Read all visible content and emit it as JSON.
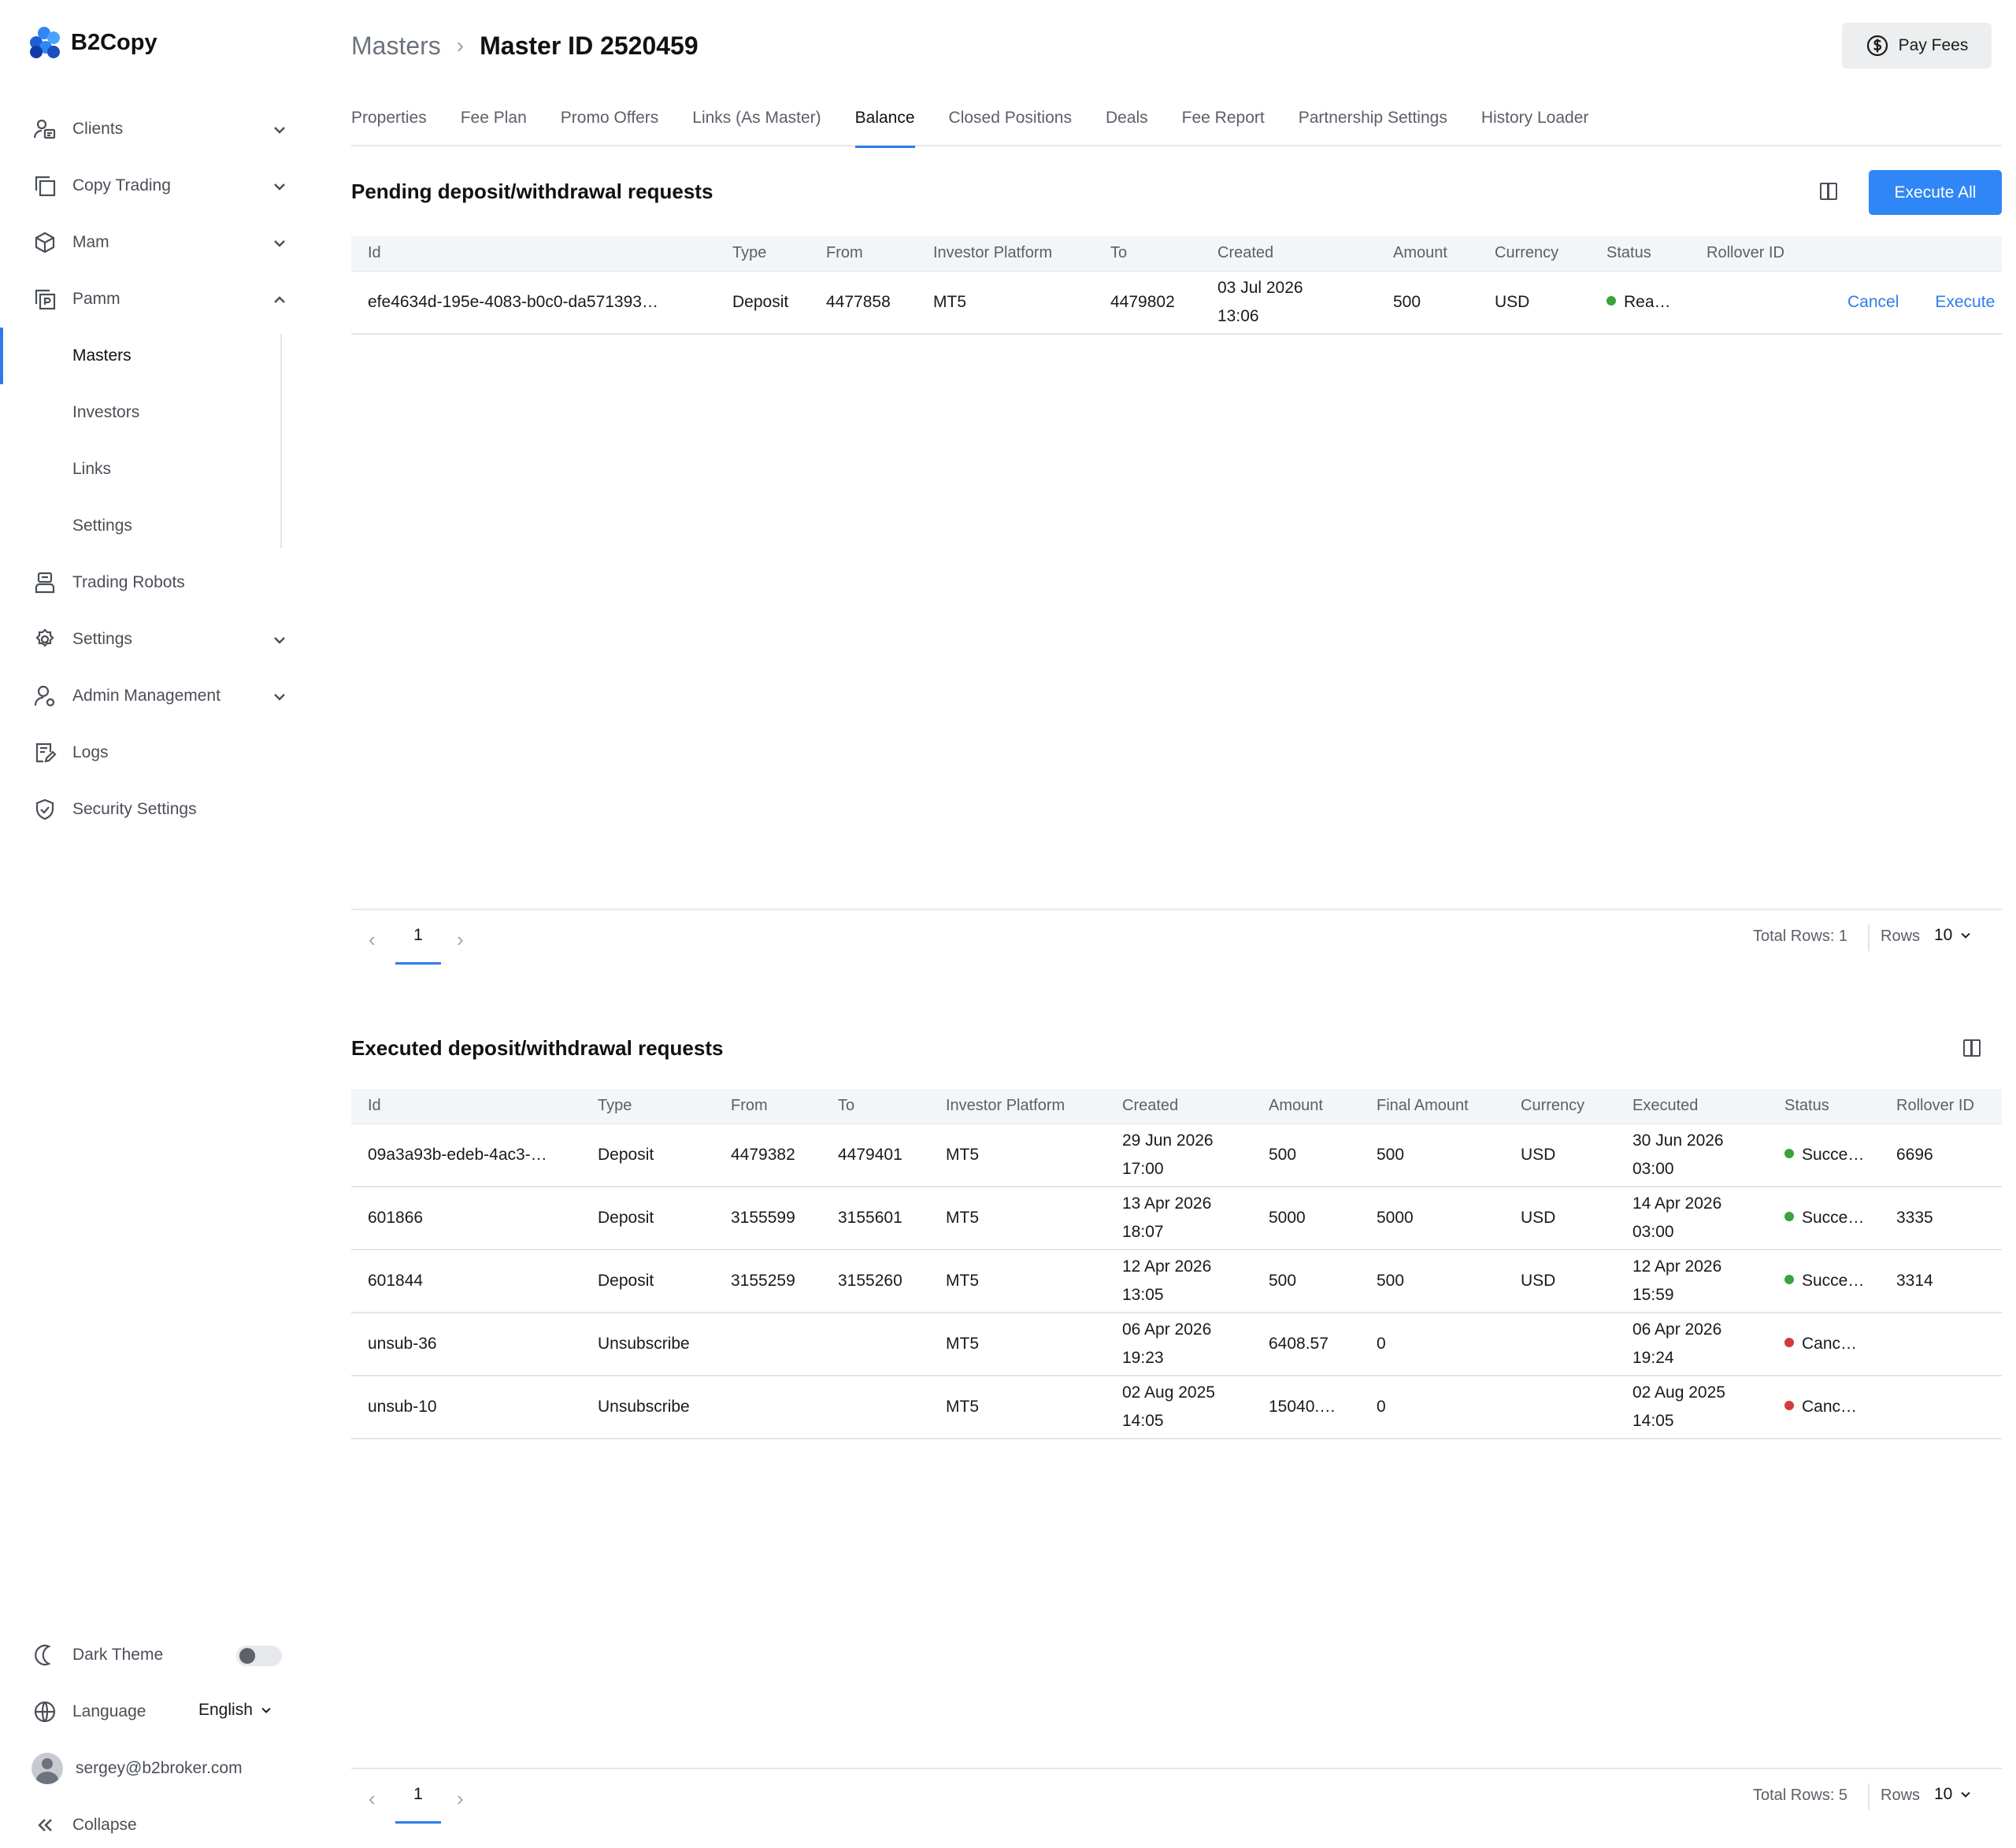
{
  "brand": {
    "name": "B2Copy"
  },
  "sidebar": {
    "items": [
      {
        "label": "Clients",
        "icon": "clients-icon",
        "expandable": true
      },
      {
        "label": "Copy Trading",
        "icon": "copy-trading-icon",
        "expandable": true
      },
      {
        "label": "Mam",
        "icon": "mam-icon",
        "expandable": true
      },
      {
        "label": "Pamm",
        "icon": "pamm-icon",
        "expandable": true,
        "expanded": true
      }
    ],
    "pamm_sub": [
      {
        "label": "Masters",
        "active": true
      },
      {
        "label": "Investors"
      },
      {
        "label": "Links"
      },
      {
        "label": "Settings"
      }
    ],
    "items_after": [
      {
        "label": "Trading Robots",
        "icon": "robot-icon",
        "expandable": false
      },
      {
        "label": "Settings",
        "icon": "gear-icon",
        "expandable": true
      },
      {
        "label": "Admin Management",
        "icon": "admin-icon",
        "expandable": true
      },
      {
        "label": "Logs",
        "icon": "logs-icon",
        "expandable": false
      },
      {
        "label": "Security Settings",
        "icon": "shield-icon",
        "expandable": false
      }
    ],
    "bottom": {
      "dark_theme": "Dark Theme",
      "language": "Language",
      "language_value": "English",
      "user_email": "sergey@b2broker.com",
      "collapse": "Collapse"
    }
  },
  "header": {
    "breadcrumb_root": "Masters",
    "breadcrumb_current": "Master ID 2520459",
    "pay_fees": "Pay Fees"
  },
  "tabs": [
    "Properties",
    "Fee Plan",
    "Promo Offers",
    "Links (As Master)",
    "Balance",
    "Closed Positions",
    "Deals",
    "Fee Report",
    "Partnership Settings",
    "History Loader"
  ],
  "active_tab": "Balance",
  "pending": {
    "title": "Pending deposit/withdrawal requests",
    "execute_all": "Execute All",
    "columns": [
      "Id",
      "Type",
      "From",
      "Investor Platform",
      "To",
      "Created",
      "Amount",
      "Currency",
      "Status",
      "Rollover ID",
      ""
    ],
    "rows": [
      {
        "id": "efe4634d-195e-4083-b0c0-da571393…",
        "type": "Deposit",
        "from": "4477858",
        "platform": "MT5",
        "to": "4479802",
        "created_date": "03 Jul 2026",
        "created_time": "13:06",
        "amount": "500",
        "currency": "USD",
        "status": "Rea…",
        "status_color": "#3aa33a",
        "rollover": "",
        "cancel": "Cancel",
        "execute": "Execute"
      }
    ],
    "pager": {
      "page": "1",
      "total": "Total Rows: 1",
      "rows_label": "Rows",
      "rows_value": "10"
    }
  },
  "executed": {
    "title": "Executed deposit/withdrawal requests",
    "columns": [
      "Id",
      "Type",
      "From",
      "To",
      "Investor Platform",
      "Created",
      "Amount",
      "Final Amount",
      "Currency",
      "Executed",
      "Status",
      "Rollover ID"
    ],
    "rows": [
      {
        "id": "09a3a93b-edeb-4ac3-…",
        "type": "Deposit",
        "from": "4479382",
        "to": "4479401",
        "platform": "MT5",
        "created_date": "29 Jun 2026",
        "created_time": "17:00",
        "amount": "500",
        "final_amount": "500",
        "currency": "USD",
        "executed_date": "30 Jun 2026",
        "executed_time": "03:00",
        "status": "Succe…",
        "status_color": "#3aa33a",
        "rollover": "6696"
      },
      {
        "id": "601866",
        "type": "Deposit",
        "from": "3155599",
        "to": "3155601",
        "platform": "MT5",
        "created_date": "13 Apr 2026",
        "created_time": "18:07",
        "amount": "5000",
        "final_amount": "5000",
        "currency": "USD",
        "executed_date": "14 Apr 2026",
        "executed_time": "03:00",
        "status": "Succe…",
        "status_color": "#3aa33a",
        "rollover": "3335"
      },
      {
        "id": "601844",
        "type": "Deposit",
        "from": "3155259",
        "to": "3155260",
        "platform": "MT5",
        "created_date": "12 Apr 2026",
        "created_time": "13:05",
        "amount": "500",
        "final_amount": "500",
        "currency": "USD",
        "executed_date": "12 Apr 2026",
        "executed_time": "15:59",
        "status": "Succe…",
        "status_color": "#3aa33a",
        "rollover": "3314"
      },
      {
        "id": "unsub-36",
        "type": "Unsubscribe",
        "from": "",
        "to": "",
        "platform": "MT5",
        "created_date": "06 Apr 2026",
        "created_time": "19:23",
        "amount": "6408.57",
        "final_amount": "0",
        "currency": "",
        "executed_date": "06 Apr 2026",
        "executed_time": "19:24",
        "status": "Canc…",
        "status_color": "#d23c3c",
        "rollover": ""
      },
      {
        "id": "unsub-10",
        "type": "Unsubscribe",
        "from": "",
        "to": "",
        "platform": "MT5",
        "created_date": "02 Aug 2025",
        "created_time": "14:05",
        "amount": "15040.…",
        "final_amount": "0",
        "currency": "",
        "executed_date": "02 Aug 2025",
        "executed_time": "14:05",
        "status": "Canc…",
        "status_color": "#d23c3c",
        "rollover": ""
      }
    ],
    "pager": {
      "page": "1",
      "total": "Total Rows: 5",
      "rows_label": "Rows",
      "rows_value": "10"
    }
  },
  "colors": {
    "accent": "#2f7ce8",
    "button": "#2f86f6",
    "success": "#3aa33a",
    "cancelled": "#d23c3c"
  }
}
